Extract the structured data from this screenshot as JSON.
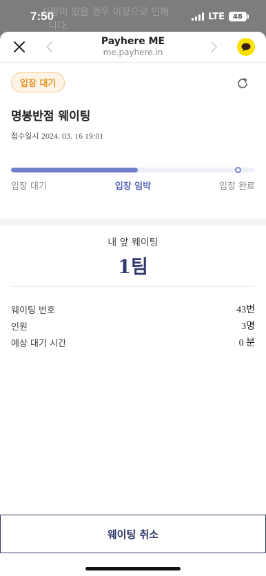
{
  "status_bar": {
    "time": "7:50",
    "network": "LTE",
    "battery": "48"
  },
  "underlay": {
    "text_line1": "사항이 있을 경우 이장으로 인해",
    "text_line2": "니다."
  },
  "nav": {
    "title": "Payhere ME",
    "url": "me.payhere.in",
    "icons": [
      "close-icon",
      "back-arrow-icon",
      "forward-arrow-icon",
      "kakaotalk-chat-icon"
    ]
  },
  "status": {
    "badge": "입장 대기",
    "store_name": "명봉반점 웨이팅",
    "received_label": "접수일시",
    "received_at": "2024. 03. 16 19:01"
  },
  "progress": {
    "fraction": 0.52,
    "steps": [
      "입장 대기",
      "입장 임박",
      "입장 완료"
    ],
    "active_index": 1
  },
  "ahead": {
    "label": "내 앞 웨이팅",
    "count": "1팀"
  },
  "info": [
    {
      "label": "웨이팅 번호",
      "value": "43번"
    },
    {
      "label": "인원",
      "value": "3명"
    },
    {
      "label": "예상 대기 시간",
      "value": "0 분"
    }
  ],
  "cancel_button": "웨이팅 취소",
  "colors": {
    "accent": "#5866b8",
    "badge_text": "#e8962a",
    "kakao_yellow": "#fae100"
  }
}
